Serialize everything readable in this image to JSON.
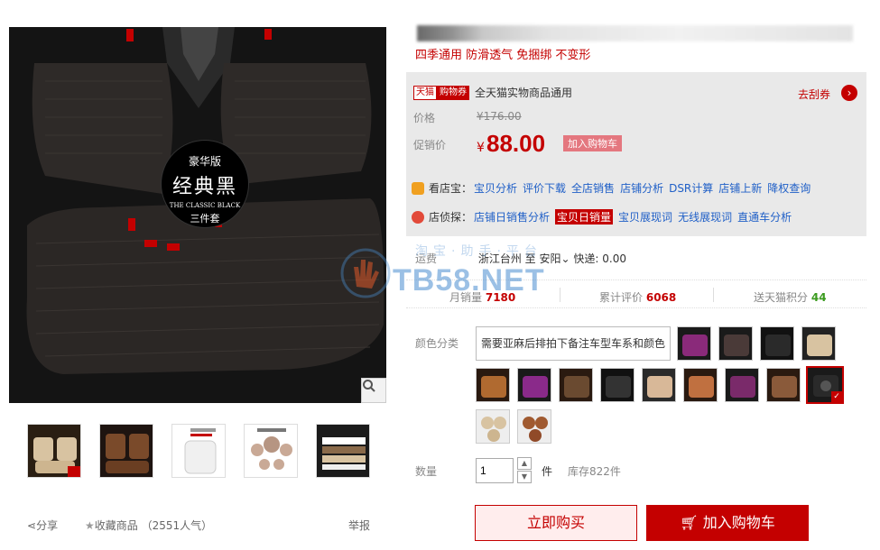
{
  "gallery": {
    "badge": {
      "edition": "豪华版",
      "name": "经典黑",
      "english": "THE CLASSIC BLACK",
      "set": "三件套"
    },
    "zoom_icon": "search-icon",
    "thumbnails": [
      {
        "label": "beige cushion set"
      },
      {
        "label": "brown cushion set"
      },
      {
        "label": "white cushion with text"
      },
      {
        "label": "cushion parts layout"
      },
      {
        "label": "cushion material layers"
      }
    ],
    "share_label": "分享",
    "favorite_label": "收藏商品",
    "favorite_count": "（2551人气）",
    "report_label": "举报"
  },
  "product": {
    "subtitle": "四季通用 防滑透气 免捆绑 不变形",
    "coupon": {
      "tag1": "天猫",
      "tag2": "购物券",
      "text": "全天猫实物商品通用",
      "action": "去刮券"
    },
    "price_label": "价格",
    "original_price": "¥176.00",
    "promo_label": "促销价",
    "currency": "¥",
    "promo_price": "88.00",
    "add_cart_tag": "加入购物车",
    "tools1": {
      "head": "看店宝：",
      "links": [
        "宝贝分析",
        "评价下载",
        "全店销售",
        "店铺分析",
        "DSR计算",
        "店铺上新",
        "降权查询"
      ]
    },
    "tools2": {
      "head": "店侦探：",
      "links": [
        "店铺日销售分析",
        "宝贝日销量",
        "宝贝展现词",
        "无线展现词",
        "直通车分析"
      ]
    },
    "shipping": {
      "label": "运费",
      "from": "浙江台州",
      "to_prefix": "至",
      "to": "安阳",
      "fee": "快递: 0.00"
    },
    "stats": {
      "monthly_sales_label": "月销量",
      "monthly_sales": "7180",
      "reviews_label": "累计评价",
      "reviews": "6068",
      "points_label": "送天猫积分",
      "points": "44"
    },
    "color_label": "颜色分类",
    "color_text_option": "需要亚麻后排拍下备注车型车系和颜色",
    "quantity_label": "数量",
    "quantity_value": "1",
    "quantity_unit": "件",
    "stock": "库存822件",
    "buy_now": "立即购买",
    "add_to_cart": "加入购物车"
  },
  "watermark": {
    "text": "TB58.NET",
    "sub": "淘宝·助手·平台"
  },
  "colors": {
    "accent": "#c40000",
    "link": "#1f5fc7",
    "points": "#3b9b1f"
  }
}
